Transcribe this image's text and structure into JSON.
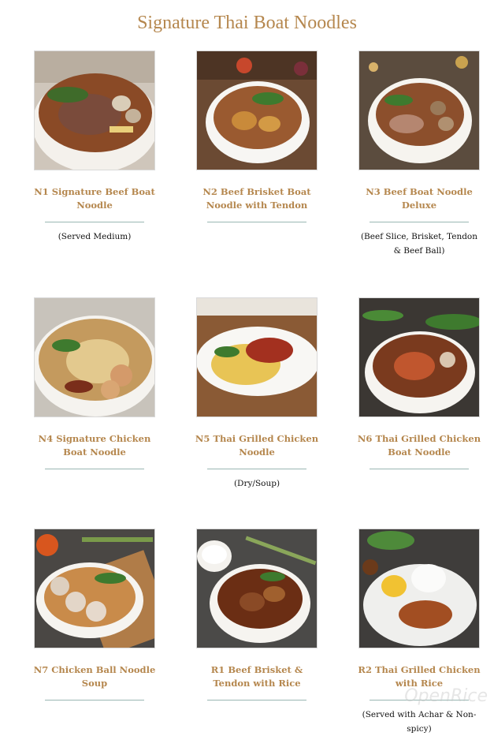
{
  "page_title": "Signature Thai Boat Noodles",
  "watermark": "OpenRice",
  "items": [
    {
      "name": "N1 Signature Beef Boat Noodle",
      "note": "(Served Medium)"
    },
    {
      "name": "N2 Beef Brisket Boat Noodle with Tendon",
      "note": ""
    },
    {
      "name": "N3 Beef Boat Noodle Deluxe",
      "note": "(Beef Slice, Brisket, Tendon & Beef Ball)"
    },
    {
      "name": "N4 Signature Chicken Boat Noodle",
      "note": ""
    },
    {
      "name": "N5 Thai Grilled Chicken Noodle",
      "note": "(Dry/Soup)"
    },
    {
      "name": "N6 Thai Grilled Chicken Boat Noodle",
      "note": ""
    },
    {
      "name": "N7 Chicken Ball Noodle Soup",
      "note": ""
    },
    {
      "name": "R1 Beef Brisket & Tendon with Rice",
      "note": ""
    },
    {
      "name": "R2 Thai Grilled Chicken with Rice",
      "note": "(Served with Achar & Non-spicy)"
    }
  ],
  "colors": {
    "accent": "#b5874e",
    "rule": "#9ab7b3"
  }
}
